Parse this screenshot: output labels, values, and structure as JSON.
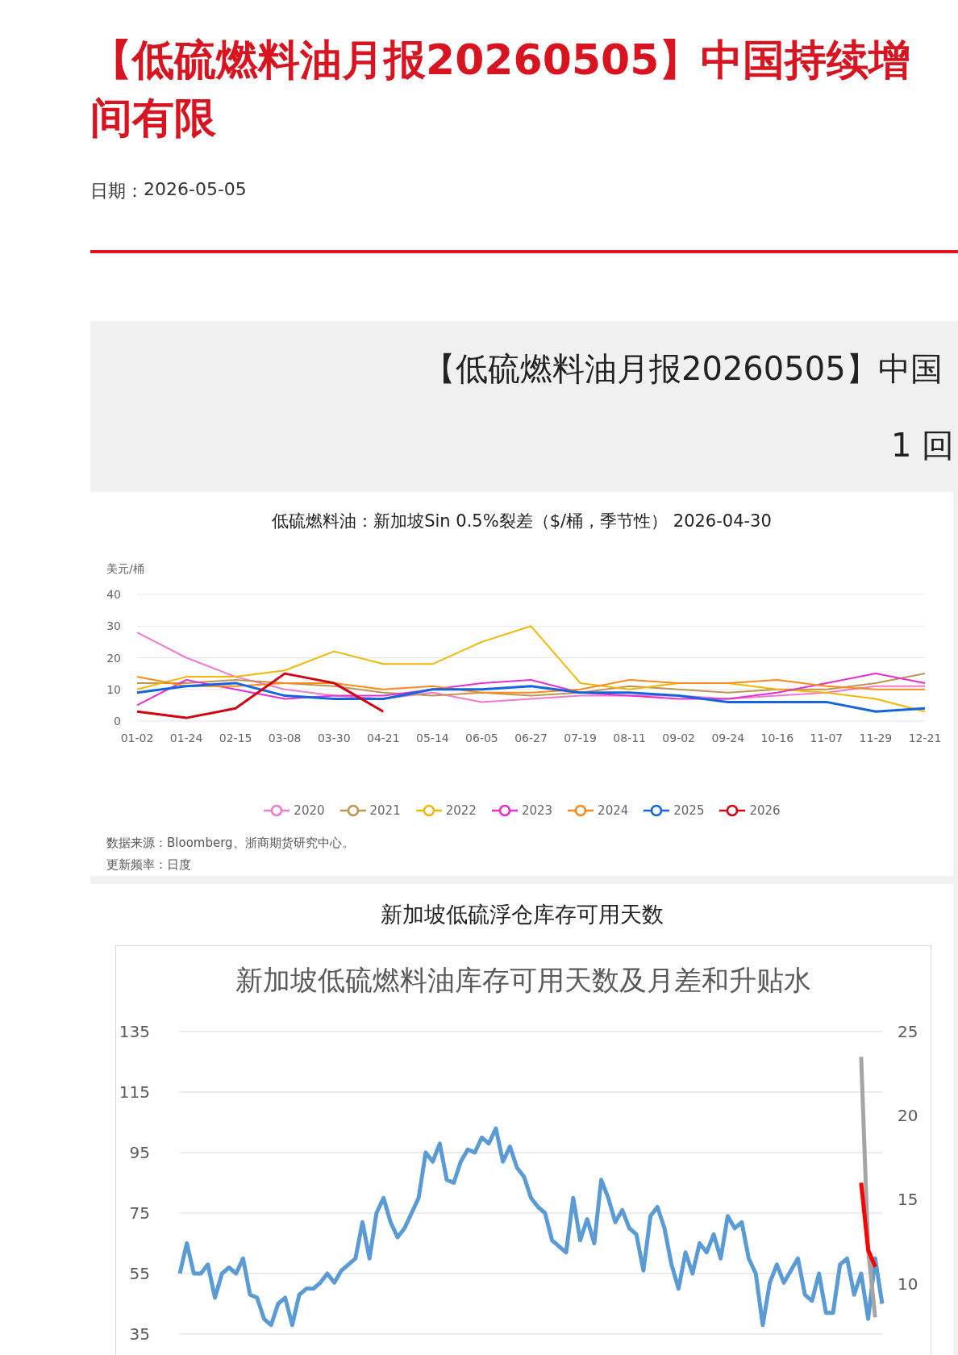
{
  "article": {
    "title_line_1": "【低硫燃料油月报20260505】中国持续增",
    "title_line_2": "间有限",
    "date_label": "日期：",
    "date": "2026-05-05"
  },
  "banner": {
    "heading": "【低硫燃料油月报20260505】中国",
    "subheading": "1 回"
  },
  "figure_1": {
    "caption": "低硫燃料油：新加坡Sin 0.5%裂差（$/桶，季节性） 2026-04-30",
    "source": "数据来源：Bloomberg、浙商期货研究中心。",
    "frequency": "更新频率：日度",
    "chart_data": {
      "type": "line",
      "grid": true,
      "ylabel": "美元/桶",
      "categories": [
        "01-02",
        "01-24",
        "02-15",
        "03-08",
        "03-30",
        "04-21",
        "05-14",
        "06-05",
        "06-27",
        "07-19",
        "08-11",
        "09-02",
        "09-24",
        "10-16",
        "11-07",
        "11-29",
        "12-21"
      ],
      "ylim": [
        0,
        40
      ],
      "yticks": [
        0,
        10,
        20,
        30,
        40
      ],
      "series": [
        {
          "name": "2020",
          "color": "#f07acb",
          "values": [
            28,
            20,
            14,
            10,
            8,
            7,
            9,
            6,
            7,
            8,
            8,
            8,
            7,
            8,
            9,
            11,
            11
          ]
        },
        {
          "name": "2021",
          "color": "#c09450",
          "values": [
            12,
            12,
            13,
            12,
            11,
            9,
            8,
            9,
            8,
            9,
            11,
            10,
            9,
            10,
            10,
            12,
            15
          ]
        },
        {
          "name": "2022",
          "color": "#f2b705",
          "values": [
            10,
            14,
            14,
            16,
            22,
            18,
            18,
            25,
            30,
            12,
            10,
            12,
            12,
            10,
            9,
            7,
            3
          ]
        },
        {
          "name": "2023",
          "color": "#e52fd0",
          "values": [
            5,
            13,
            10,
            7,
            8,
            8,
            10,
            12,
            13,
            9,
            8,
            7,
            7,
            9,
            12,
            15,
            12
          ]
        },
        {
          "name": "2024",
          "color": "#fb8a1a",
          "values": [
            14,
            11,
            11,
            12,
            12,
            10,
            11,
            9,
            9,
            10,
            13,
            12,
            12,
            13,
            11,
            10,
            10
          ]
        },
        {
          "name": "2025",
          "color": "#1464e0",
          "values": [
            9,
            11,
            12,
            8,
            7,
            7,
            10,
            10,
            11,
            9,
            9,
            8,
            6,
            6,
            6,
            3,
            4
          ]
        },
        {
          "name": "2026",
          "color": "#d4000f",
          "values": [
            3,
            1,
            4,
            15,
            12,
            3,
            null,
            null,
            null,
            null,
            null,
            null,
            null,
            null,
            null,
            null,
            null
          ]
        }
      ]
    }
  },
  "figure_2": {
    "caption": "新加坡低硫浮仓库存可用天数",
    "chart_data": {
      "type": "line",
      "grid": true,
      "title": "新加坡低硫燃料油库存可用天数及月差和升贴水",
      "ylim": [
        35,
        135
      ],
      "yticks": [
        35,
        55,
        75,
        95,
        115,
        135
      ],
      "y2lim": [
        7,
        25
      ],
      "y2ticks": [
        10,
        15,
        20,
        25
      ],
      "series": [
        {
          "color": "#5b9bd5",
          "values": [
            55,
            65,
            55,
            55,
            58,
            47,
            55,
            57,
            55,
            60,
            48,
            47,
            40,
            38,
            45,
            47,
            38,
            48,
            50,
            50,
            52,
            55,
            52,
            56,
            58,
            60,
            72,
            60,
            75,
            80,
            72,
            67,
            70,
            75,
            80,
            95,
            92,
            98,
            86,
            85,
            92,
            96,
            95,
            100,
            98,
            103,
            92,
            97,
            90,
            87,
            80,
            77,
            75,
            66,
            64,
            62,
            80,
            66,
            73,
            65,
            86,
            80,
            72,
            76,
            70,
            68,
            56,
            74,
            77,
            70,
            58,
            50,
            62,
            55,
            65,
            62,
            68,
            60,
            74,
            70,
            72,
            60,
            55,
            38,
            52,
            58,
            52,
            56,
            60,
            48,
            46,
            55,
            42,
            42,
            58,
            60,
            48,
            55,
            40,
            60,
            45
          ]
        },
        {
          "color": "#a5a5a5",
          "axis": "y2",
          "values": [
            null,
            null,
            null,
            null,
            null,
            null,
            null,
            null,
            null,
            null,
            null,
            null,
            null,
            null,
            null,
            null,
            null,
            null,
            null,
            null,
            null,
            null,
            null,
            null,
            null,
            null,
            null,
            null,
            null,
            null,
            null,
            null,
            null,
            null,
            null,
            null,
            null,
            null,
            null,
            null,
            null,
            null,
            null,
            null,
            null,
            null,
            null,
            null,
            null,
            null,
            null,
            null,
            null,
            null,
            null,
            null,
            null,
            null,
            null,
            null,
            null,
            null,
            null,
            null,
            null,
            null,
            null,
            null,
            null,
            null,
            null,
            null,
            null,
            null,
            null,
            null,
            null,
            null,
            null,
            null,
            null,
            null,
            null,
            null,
            null,
            null,
            null,
            null,
            null,
            null,
            null,
            null,
            null,
            null,
            null,
            null,
            null,
            23.5,
            12,
            8,
            null
          ]
        },
        {
          "color": "#ff0000",
          "axis": "y2",
          "values": [
            null,
            null,
            null,
            null,
            null,
            null,
            null,
            null,
            null,
            null,
            null,
            null,
            null,
            null,
            null,
            null,
            null,
            null,
            null,
            null,
            null,
            null,
            null,
            null,
            null,
            null,
            null,
            null,
            null,
            null,
            null,
            null,
            null,
            null,
            null,
            null,
            null,
            null,
            null,
            null,
            null,
            null,
            null,
            null,
            null,
            null,
            null,
            null,
            null,
            null,
            null,
            null,
            null,
            null,
            null,
            null,
            null,
            null,
            null,
            null,
            null,
            null,
            null,
            null,
            null,
            null,
            null,
            null,
            null,
            null,
            null,
            null,
            null,
            null,
            null,
            null,
            null,
            null,
            null,
            null,
            null,
            null,
            null,
            null,
            null,
            null,
            null,
            null,
            null,
            null,
            null,
            null,
            null,
            null,
            null,
            null,
            null,
            16,
            12,
            11,
            null
          ]
        }
      ]
    }
  }
}
